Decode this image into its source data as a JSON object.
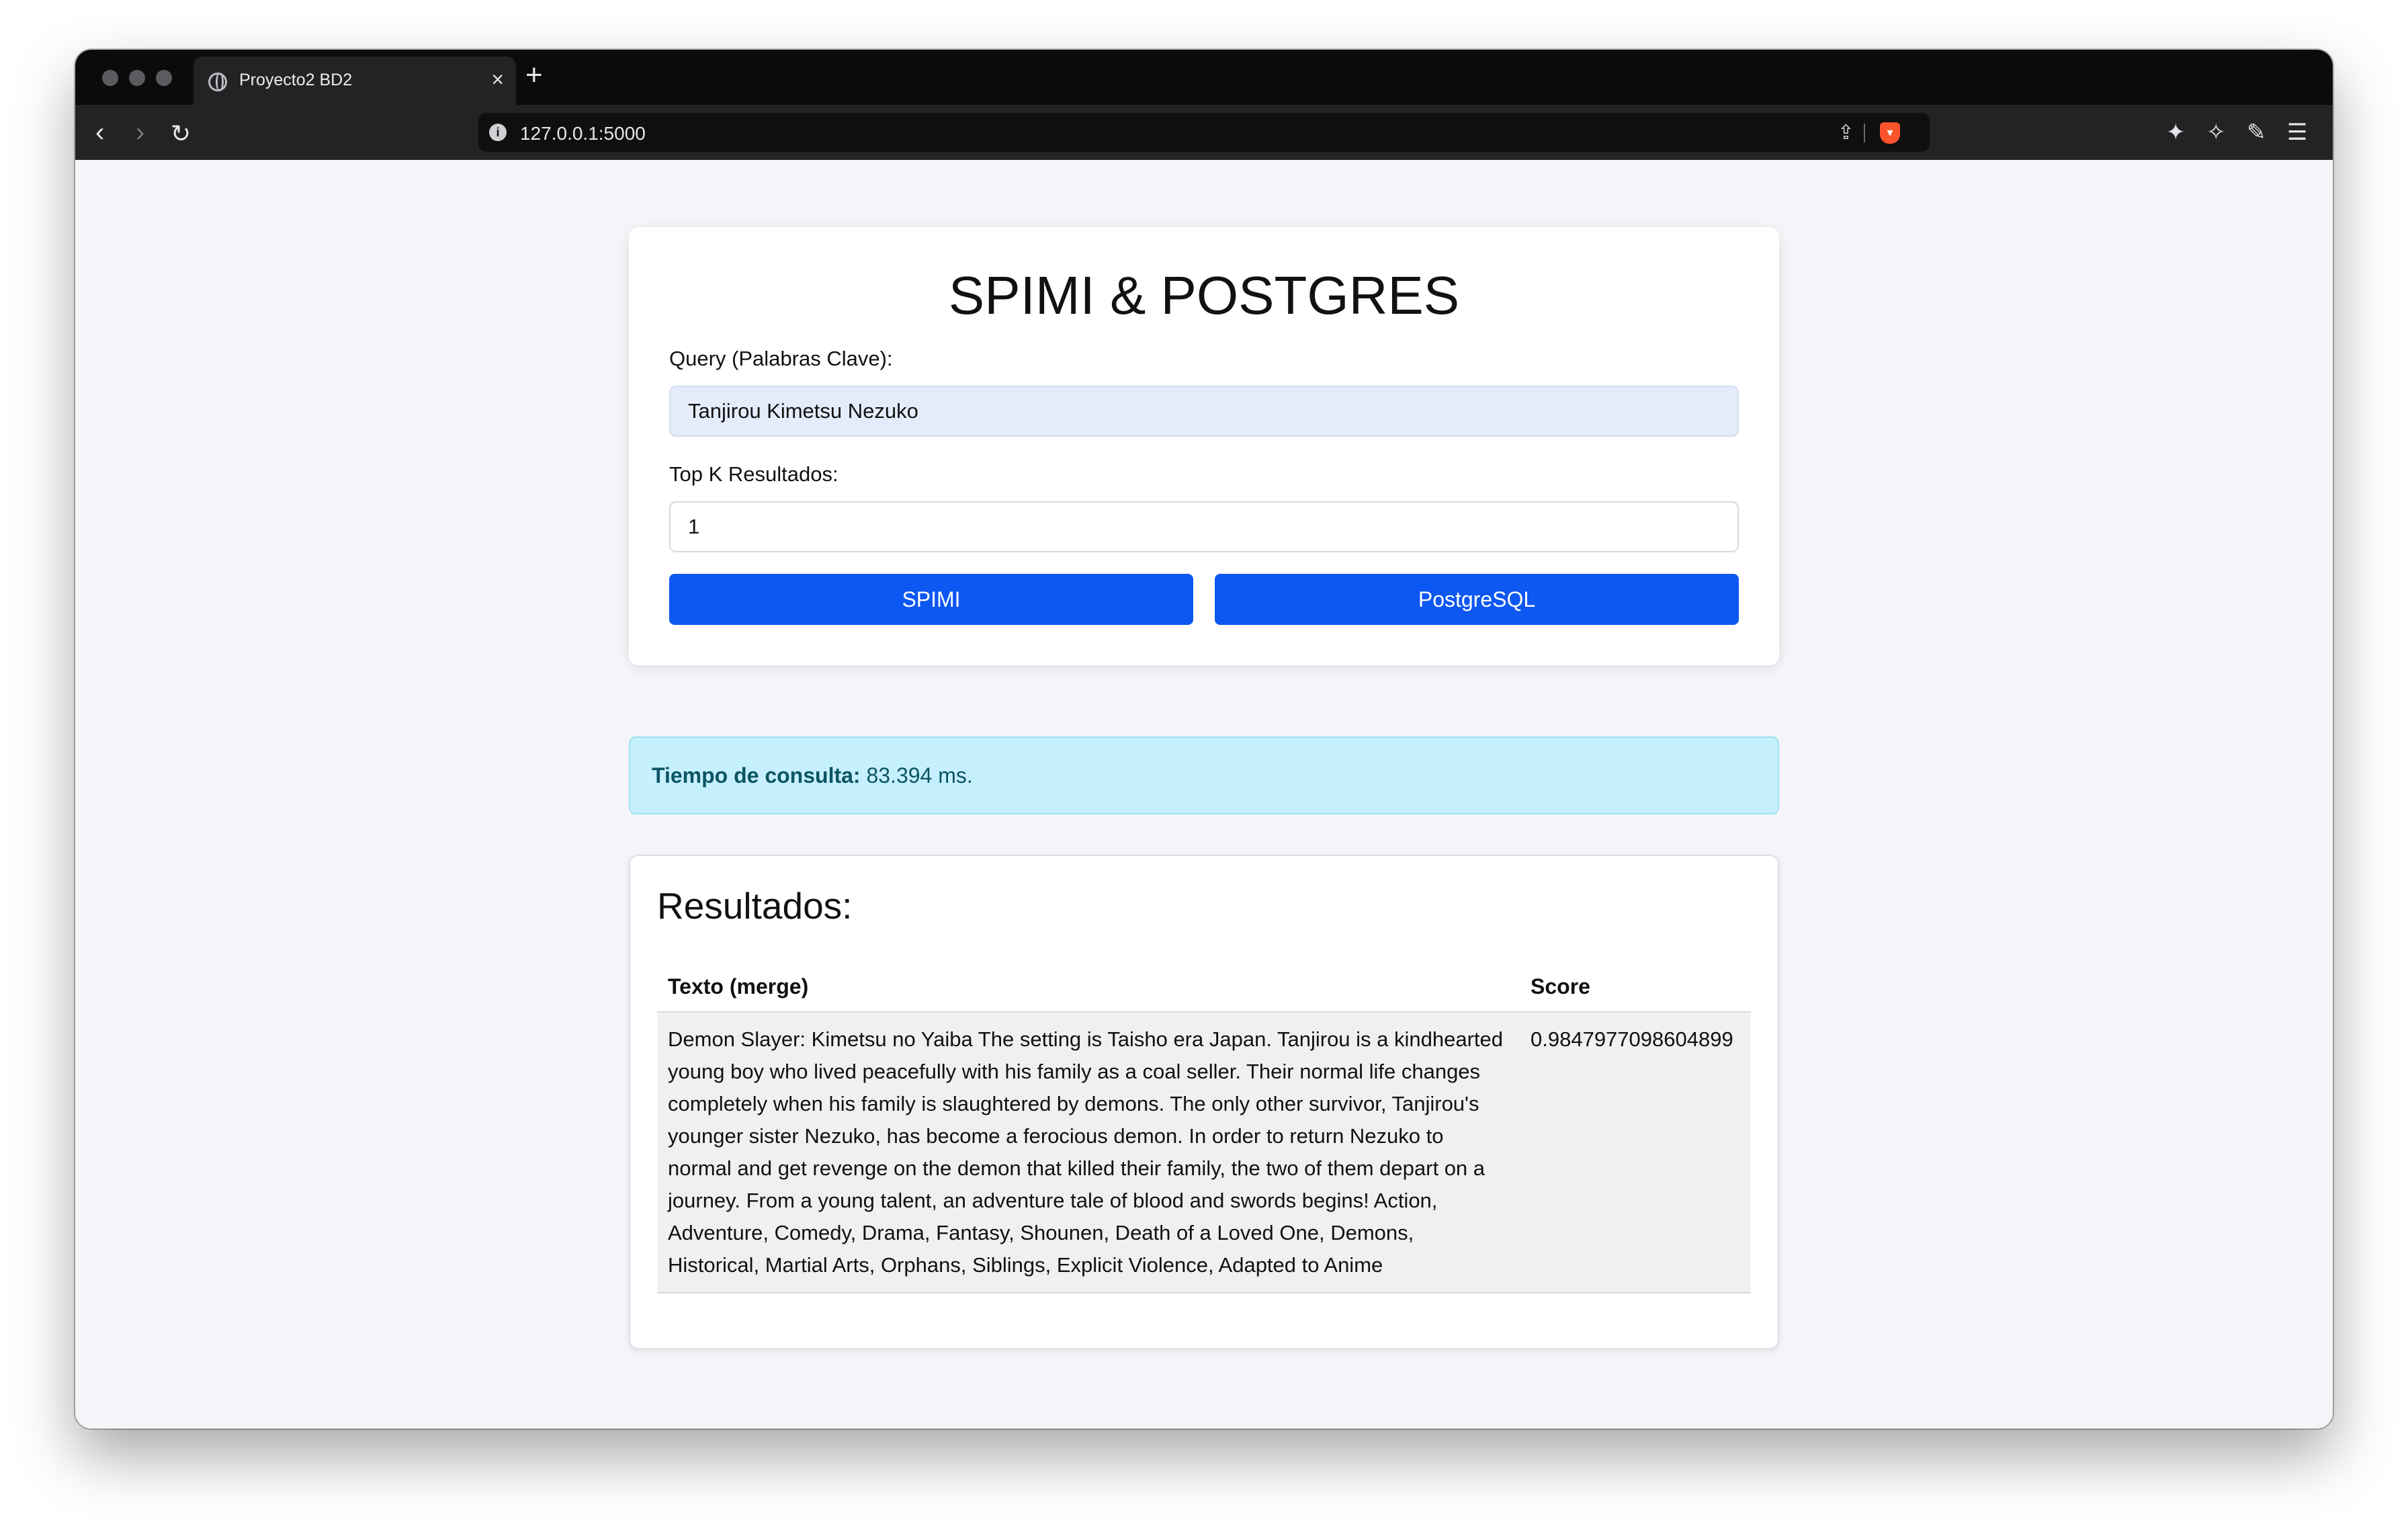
{
  "browser": {
    "tab_title": "Proyecto2 BD2",
    "tab_close": "×",
    "new_tab": "+",
    "url": "127.0.0.1:5000"
  },
  "icons": {
    "back": "chevron-left-icon",
    "forward": "chevron-right-icon",
    "reload": "reload-icon",
    "site_info": "info-icon",
    "share": "share-icon",
    "brave": "brave-shield-icon",
    "extensions": "puzzle-icon",
    "leo": "sparkle-icon",
    "wallet": "pen-icon",
    "menu": "hamburger-menu-icon"
  },
  "form": {
    "title": "SPIMI & POSTGRES",
    "query_label": "Query (Palabras Clave):",
    "query_value": "Tanjirou Kimetsu Nezuko",
    "topk_label": "Top K Resultados:",
    "topk_value": "1",
    "spimi_button": "SPIMI",
    "postgres_button": "PostgreSQL"
  },
  "alert": {
    "label": "Tiempo de consulta:",
    "value": "83.394 ms."
  },
  "results": {
    "title": "Resultados:",
    "headers": [
      "Texto (merge)",
      "Score"
    ],
    "rows": [
      {
        "text": "Demon Slayer: Kimetsu no Yaiba The setting is Taisho era Japan. Tanjirou is a kindhearted young boy who lived peacefully with his family as a coal seller. Their normal life changes completely when his family is slaughtered by demons. The only other survivor, Tanjirou's younger sister Nezuko, has become a ferocious demon. In order to return Nezuko to normal and get revenge on the demon that killed their family, the two of them depart on a journey. From a young talent, an adventure tale of blood and swords begins! Action, Adventure, Comedy, Drama, Fantasy, Shounen, Death of a Loved One, Demons, Historical, Martial Arts, Orphans, Siblings, Explicit Violence, Adapted to Anime",
        "score": "0.9847977098604899"
      }
    ]
  },
  "colors": {
    "primary_button": "#0d57f2",
    "alert_background": "#c6f0fd",
    "alert_text": "#0b5565",
    "page_background": "#f3f5f9"
  }
}
